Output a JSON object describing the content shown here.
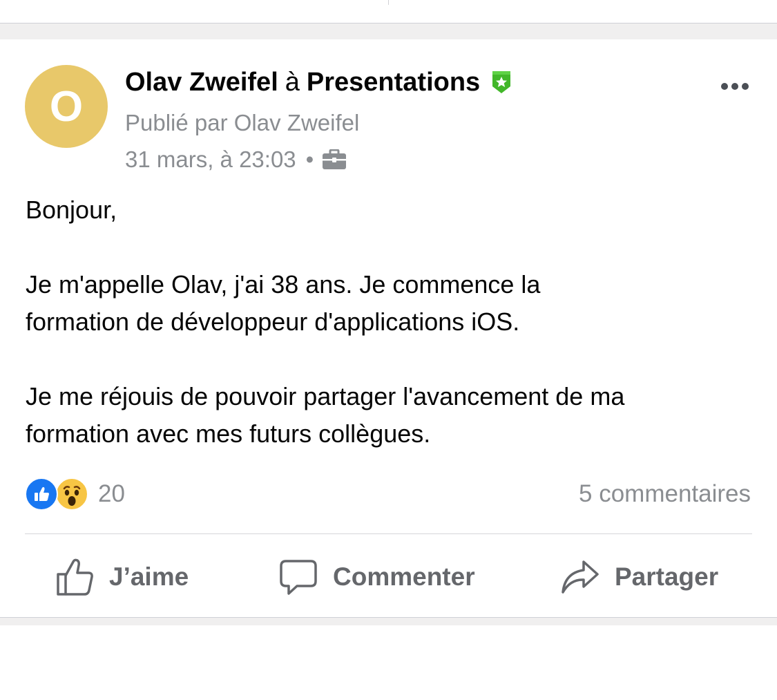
{
  "post": {
    "avatar_letter": "O",
    "author": "Olav Zweifel",
    "preposition": "à",
    "group": "Presentations",
    "posted_by": "Publié par Olav Zweifel",
    "timestamp": "31 mars, à 23:03",
    "separator": "•",
    "audience_icon": "briefcase-icon",
    "badge_icon": "group-badge-star-icon",
    "body": {
      "line1": "Bonjour,",
      "line2": "Je m'appelle Olav, j'ai 38 ans. Je commence la",
      "line3": "formation de développeur d'applications iOS.",
      "line4": "Je me réjouis de pouvoir partager l'avancement de ma",
      "line5": "formation avec mes futurs collègues."
    }
  },
  "reactions": {
    "types": [
      "like",
      "wow"
    ],
    "count": "20",
    "comments": "5 commentaires"
  },
  "actions": {
    "like_label": "J’aime",
    "comment_label": "Commenter",
    "share_label": "Partager"
  },
  "colors": {
    "avatar_bg": "#e8c86a",
    "badge": "#42b72a",
    "like_blue": "#1877f2",
    "secondary_text": "#8a8d91",
    "action_text": "#65676b"
  }
}
